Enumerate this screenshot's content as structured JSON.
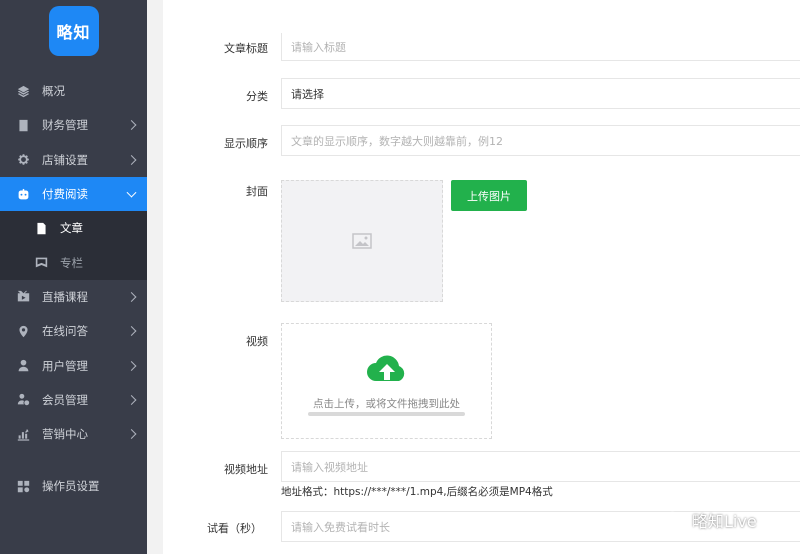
{
  "logo": {
    "text": "略知"
  },
  "sidebar": {
    "items": [
      {
        "label": "概况",
        "icon": "layers-icon"
      },
      {
        "label": "财务管理",
        "icon": "ledger-icon"
      },
      {
        "label": "店铺设置",
        "icon": "gear-icon"
      },
      {
        "label": "付费阅读",
        "icon": "robot-icon"
      },
      {
        "label": "直播课程",
        "icon": "video-icon"
      },
      {
        "label": "在线问答",
        "icon": "location-icon"
      },
      {
        "label": "用户管理",
        "icon": "user-icon"
      },
      {
        "label": "会员管理",
        "icon": "member-icon"
      },
      {
        "label": "营销中心",
        "icon": "chart-icon"
      },
      {
        "label": "操作员设置",
        "icon": "operator-icon"
      }
    ],
    "sub_items": [
      {
        "label": "文章",
        "icon": "document-icon"
      },
      {
        "label": "专栏",
        "icon": "column-icon"
      }
    ]
  },
  "form": {
    "title_label": "文章标题",
    "title_placeholder": "请输入标题",
    "category_label": "分类",
    "category_value": "请选择",
    "order_label": "显示顺序",
    "order_placeholder": "文章的显示顺序，数字越大则越靠前，例12",
    "cover_label": "封面",
    "upload_image_label": "上传图片",
    "video_label": "视频",
    "video_hint": "点击上传，或将文件拖拽到此处",
    "video_url_label": "视频地址",
    "video_url_placeholder": "请输入视频地址",
    "format_note": "地址格式：https://***/***/1.mp4,后缀名必须是MP4格式",
    "trial_label": "试看（秒）",
    "trial_placeholder": "请输入免费试看时长"
  },
  "watermark": {
    "text": "略知Live"
  },
  "colors": {
    "sidebar_bg": "#393d49",
    "accent": "#1e88f5",
    "upload_green": "#22b14c"
  }
}
